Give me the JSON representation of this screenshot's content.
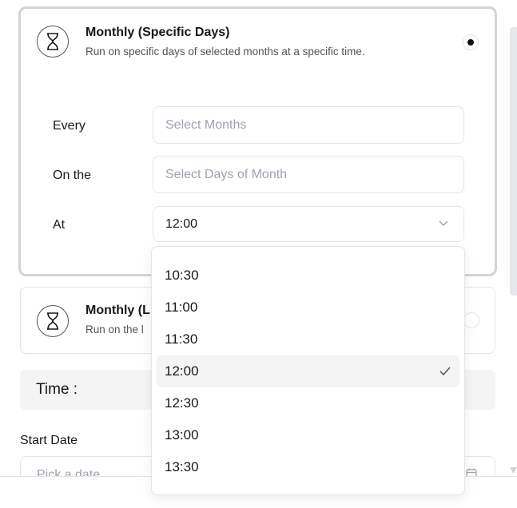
{
  "monthly_specific": {
    "title": "Monthly (Specific Days)",
    "description": "Run on specific days of selected months at a specific time.",
    "selected": true,
    "icon": "hourglass-icon",
    "rows": {
      "every_label": "Every",
      "every_placeholder": "Select Months",
      "on_the_label": "On the",
      "on_the_placeholder": "Select Days of Month",
      "at_label": "At",
      "at_value": "12:00"
    }
  },
  "monthly_last": {
    "title": "Monthly (L",
    "description": "Run on the l",
    "selected": false,
    "icon": "hourglass-icon"
  },
  "time_section": {
    "label": "Time :"
  },
  "start_date": {
    "label": "Start Date",
    "placeholder": "Pick a date"
  },
  "time_dropdown": {
    "options": [
      "10:30",
      "11:00",
      "11:30",
      "12:00",
      "12:30",
      "13:00",
      "13:30"
    ],
    "selected": "12:00"
  },
  "colors": {
    "accent": "#18181b",
    "border": "#e4e4e7",
    "selected_bg": "#f4f4f5"
  }
}
